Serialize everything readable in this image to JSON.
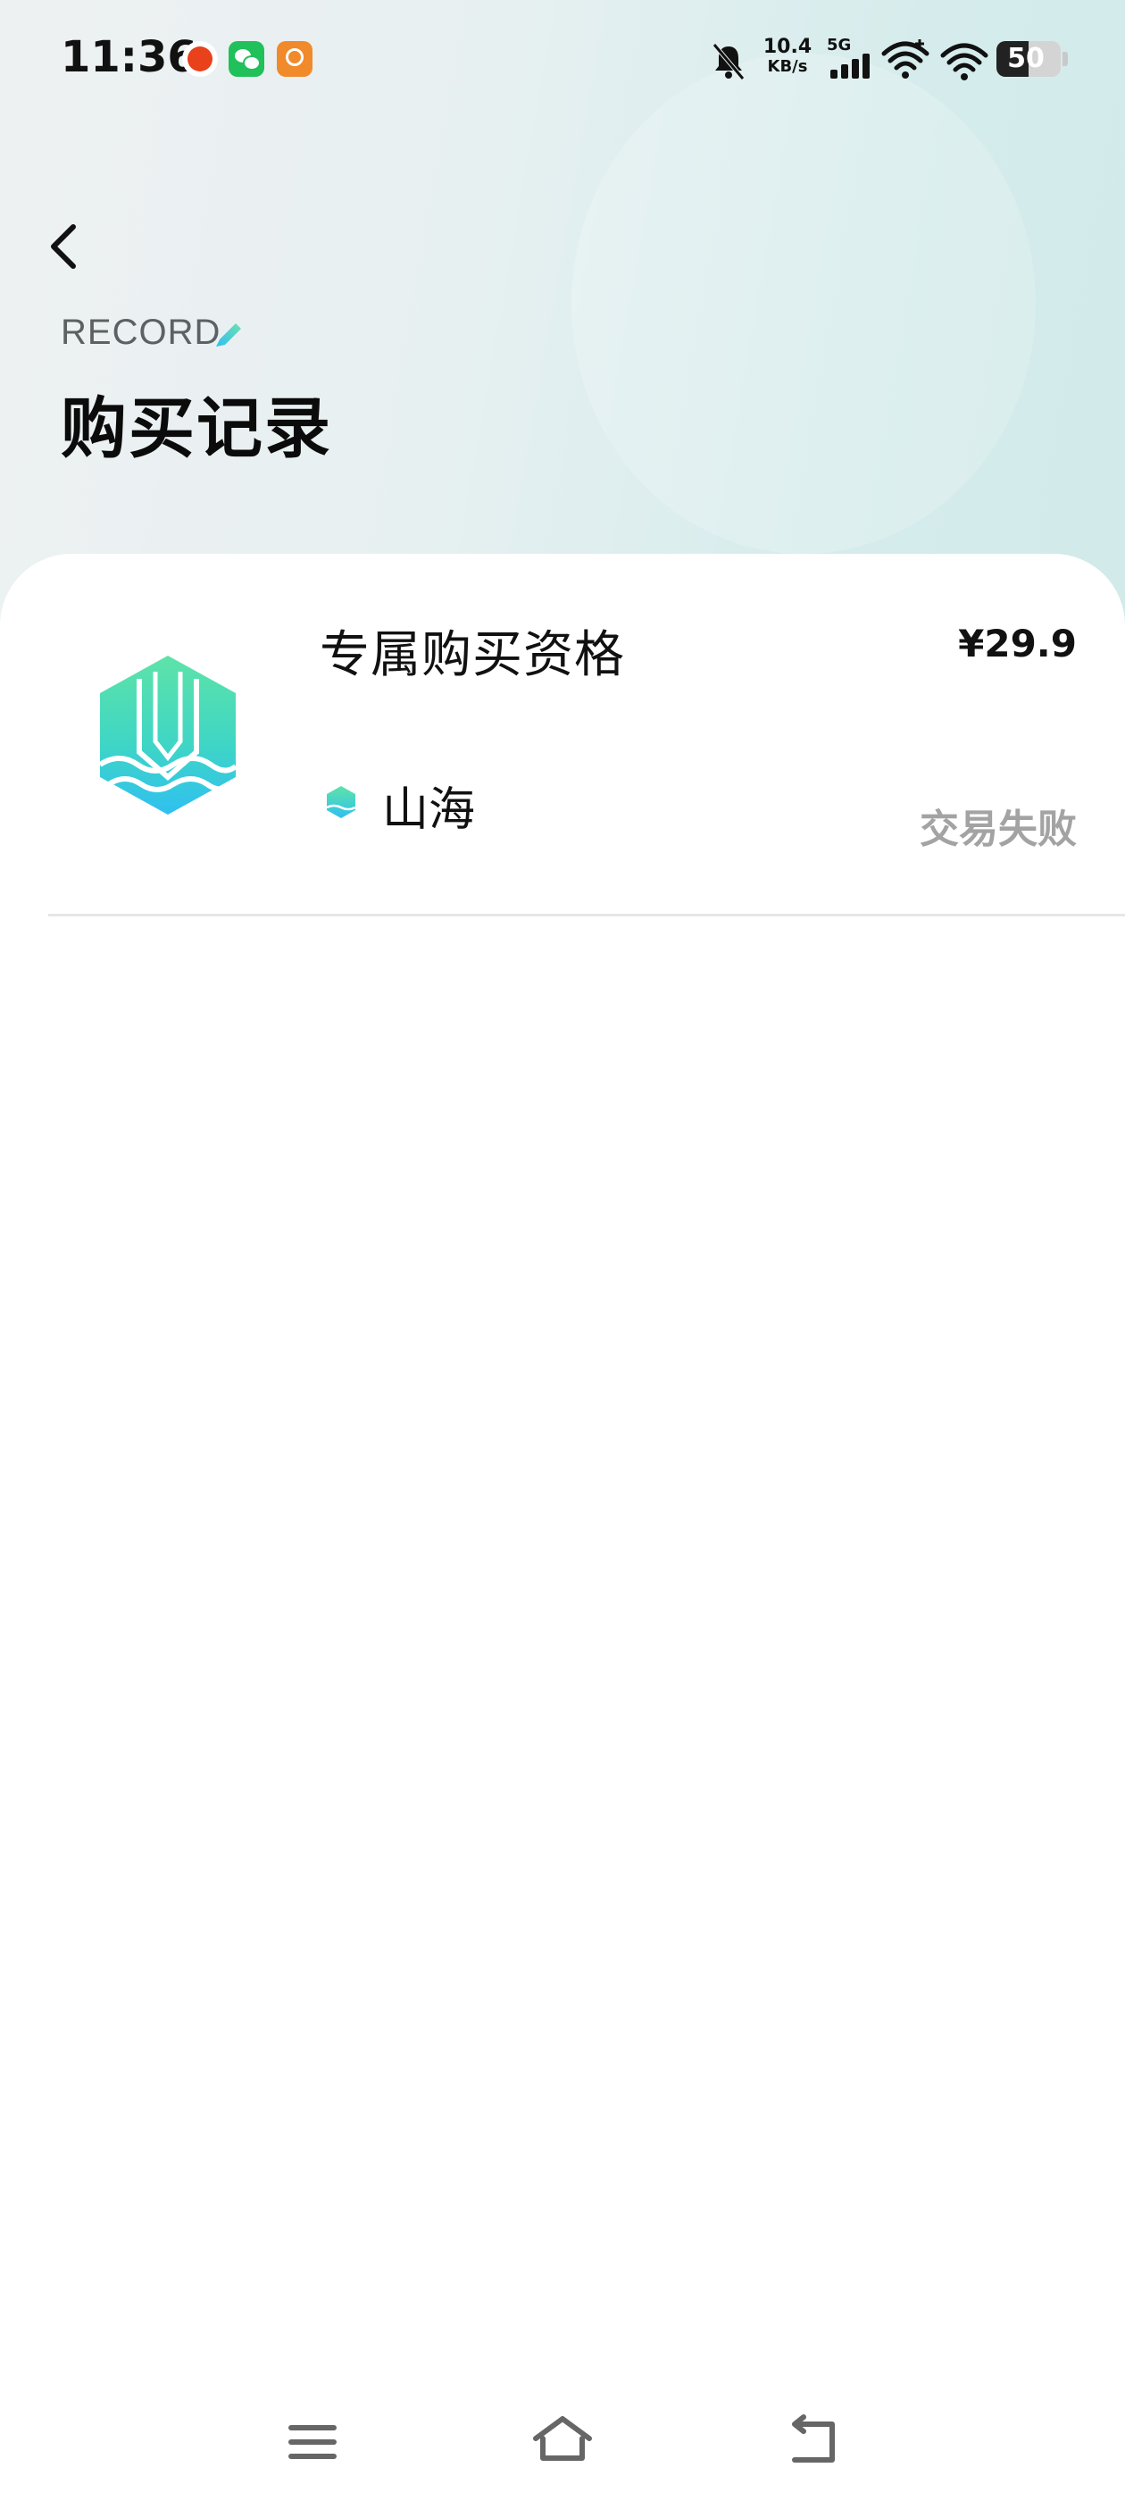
{
  "status_bar": {
    "time": "11:36",
    "network_speed_value": "10.4",
    "network_speed_unit": "KB/s",
    "network_type": "5G",
    "battery_level": "50",
    "notification_icons": [
      "weibo-icon",
      "wechat-icon",
      "video-app-icon"
    ]
  },
  "header": {
    "subtitle": "RECORD",
    "title": "购买记录"
  },
  "records": [
    {
      "product_name": "专属购买资格",
      "price": "¥29.9",
      "brand": "山海",
      "status": "交易失败"
    }
  ],
  "colors": {
    "accent_teal": "#3fd6c5",
    "accent_blue": "#2fc0f0",
    "status_gray": "#a3a3a3"
  },
  "nav": {
    "buttons": [
      "menu-icon",
      "home-icon",
      "back-icon"
    ]
  }
}
